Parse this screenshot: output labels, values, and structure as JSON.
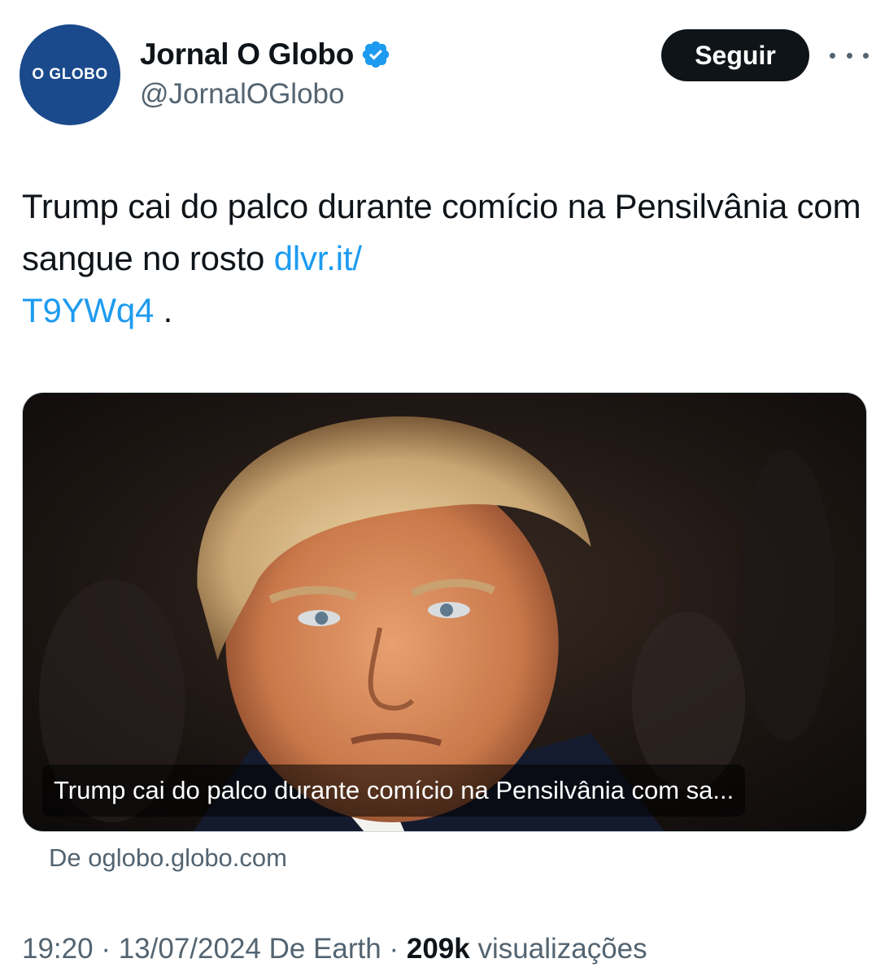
{
  "account": {
    "avatar_text": "O GLOBO",
    "display_name": "Jornal O Globo",
    "verified_badge_icon": "verified-badge-icon",
    "handle": "@JornalOGlobo",
    "follow_label": "Seguir",
    "more_icon": "more-icon"
  },
  "tweet": {
    "text": "Trump cai do palco durante comício na Pensilvânia com sangue no rosto ",
    "link_text": "dlvr.it/\nT9YWq4",
    "link_line1": "dlvr.it/",
    "link_line2": "T9YWq4",
    "trailing": " ."
  },
  "card": {
    "caption": "Trump cai do palco durante comício na Pensilvânia com sa...",
    "source": "De oglobo.globo.com"
  },
  "meta": {
    "time": "19:20",
    "date": "13/07/2024",
    "via": "De Earth",
    "views_count": "209k",
    "views_label": "visualizações",
    "separator": "·"
  },
  "colors": {
    "avatar_bg": "#1a4a8c",
    "link": "#1d9bf0",
    "verified": "#1d9bf0",
    "secondary_text": "#536471",
    "primary_text": "#0f1419"
  }
}
